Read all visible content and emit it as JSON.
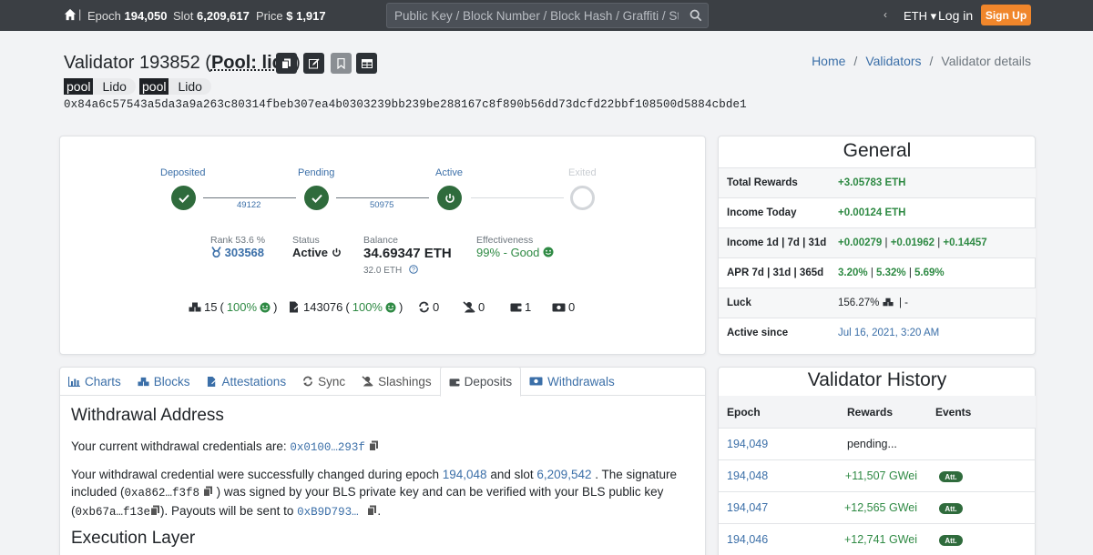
{
  "topbar": {
    "epoch_label": "Epoch",
    "epoch_value": "194,050",
    "slot_label": "Slot",
    "slot_value": "6,209,617",
    "price_label": "Price",
    "price_value": "$ 1,917",
    "search_placeholder": "Public Key / Block Number / Block Hash / Graffiti / State",
    "currency": "ETH",
    "login": "Log in",
    "signup": "Sign Up"
  },
  "header": {
    "title_prefix": "Validator 193852 (",
    "pool_link": "Pool: lido",
    "title_suffix": ")",
    "tags": [
      {
        "key": "pool",
        "value": "Lido"
      },
      {
        "key": "pool",
        "value": "Lido"
      }
    ],
    "pubkey": "0x84a6c57543a5da3a9a263c80314fbeb307ea4b0303239bb239be288167c8f890b56dd73dcfd22bbf108500d5884cbde1",
    "breadcrumb": [
      "Home",
      "Validators",
      "Validator details"
    ]
  },
  "lifecycle": {
    "stages": [
      "Deposited",
      "Pending",
      "Active",
      "Exited"
    ],
    "between": [
      "49122",
      "50975"
    ]
  },
  "metrics": {
    "rank_label": "Rank 53.6 %",
    "rank_value": "303568",
    "status_label": "Status",
    "status_value": "Active",
    "balance_label": "Balance",
    "balance_value": "34.69347 ETH",
    "balance_sub": "32.0 ETH",
    "effectiveness_label": "Effectiveness",
    "effectiveness_value": "99% - Good"
  },
  "counters": {
    "proposals_count": "15",
    "proposals_pct": "100%",
    "attestations_count": "143076",
    "attestations_pct": "100%",
    "sync": "0",
    "slashings": "0",
    "deposits": "1",
    "withdrawals": "0"
  },
  "general": {
    "title": "General",
    "rows": [
      {
        "key": "Total Rewards",
        "value": "+3.05783 ETH"
      },
      {
        "key": "Income Today",
        "value": "+0.00124 ETH"
      },
      {
        "key": "Income 1d | 7d | 31d",
        "v1": "+0.00279",
        "v2": "+0.01962",
        "v3": "+0.14457"
      },
      {
        "key": "APR 7d | 31d | 365d",
        "v1": "3.20%",
        "v2": "5.32%",
        "v3": "5.69%"
      },
      {
        "key": "Luck",
        "value": "156.27%",
        "extra": "| -"
      },
      {
        "key": "Active since",
        "value": "Jul 16, 2021, 3:20 AM"
      }
    ]
  },
  "tabs": [
    "Charts",
    "Blocks",
    "Attestations",
    "Sync",
    "Slashings",
    "Deposits",
    "Withdrawals"
  ],
  "withdrawal": {
    "title": "Withdrawal Address",
    "current_text": "Your current withdrawal credentials are:",
    "current_value": "0x0100…293f",
    "p1": "Your withdrawal credential were successfully changed during epoch",
    "epoch": "194,048",
    "p2": "and slot",
    "slot": "6,209,542",
    "p3": ". The signature",
    "p4": "included (",
    "sig": "0xa862…f3f8",
    "p5": ") was signed by your BLS private key and can be verified with your BLS public key",
    "p6": "(",
    "blskey": "0xb67a…f13e",
    "p7": "). Payouts will be sent to",
    "payout": "0xB9D793…",
    "p8": ".",
    "exec_title": "Execution Layer"
  },
  "history": {
    "title": "Validator History",
    "headers": [
      "Epoch",
      "Rewards",
      "Events"
    ],
    "rows": [
      {
        "epoch": "194,049",
        "rewards": "pending...",
        "event": ""
      },
      {
        "epoch": "194,048",
        "rewards": "+11,507 GWei",
        "event": "Att."
      },
      {
        "epoch": "194,047",
        "rewards": "+12,565 GWei",
        "event": "Att."
      },
      {
        "epoch": "194,046",
        "rewards": "+12,741 GWei",
        "event": "Att."
      }
    ]
  },
  "colors": {
    "topbar": "#3b3f44",
    "signup": "#f0862b",
    "success": "#2f6b3c",
    "link": "#3b6fa8"
  }
}
